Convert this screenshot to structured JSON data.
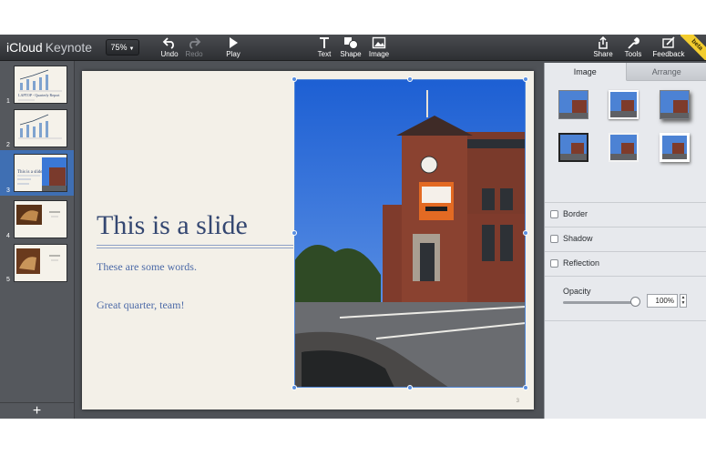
{
  "app": {
    "brand": "iCloud",
    "product": "Keynote",
    "badge": "beta"
  },
  "toolbar": {
    "zoom": "75%",
    "undo": "Undo",
    "redo": "Redo",
    "play": "Play",
    "text": "Text",
    "shape": "Shape",
    "image": "Image",
    "share": "Share",
    "tools": "Tools",
    "feedback": "Feedback"
  },
  "sidebar": {
    "slides": [
      {
        "number": "1",
        "title": "LAPTOP - Quarterly Report"
      },
      {
        "number": "2",
        "title": ""
      },
      {
        "number": "3",
        "title": "This is a slide"
      },
      {
        "number": "4",
        "title": ""
      },
      {
        "number": "5",
        "title": ""
      }
    ],
    "selected": 3,
    "add_icon": "plus-icon"
  },
  "slide": {
    "title": "This is a slide",
    "line1": "These are some words.",
    "line2": "Great quarter, team!",
    "number": "3"
  },
  "inspector": {
    "tabs": [
      "Image",
      "Arrange"
    ],
    "active_tab": "Image",
    "options": [
      "Border",
      "Shadow",
      "Reflection"
    ],
    "opacity_label": "Opacity",
    "opacity_value": "100%",
    "opacity_fraction": 1.0
  },
  "colors": {
    "accent": "#3f6fb3",
    "title": "#344771",
    "body": "#4c6aa7",
    "beta": "#f3cd2f"
  }
}
